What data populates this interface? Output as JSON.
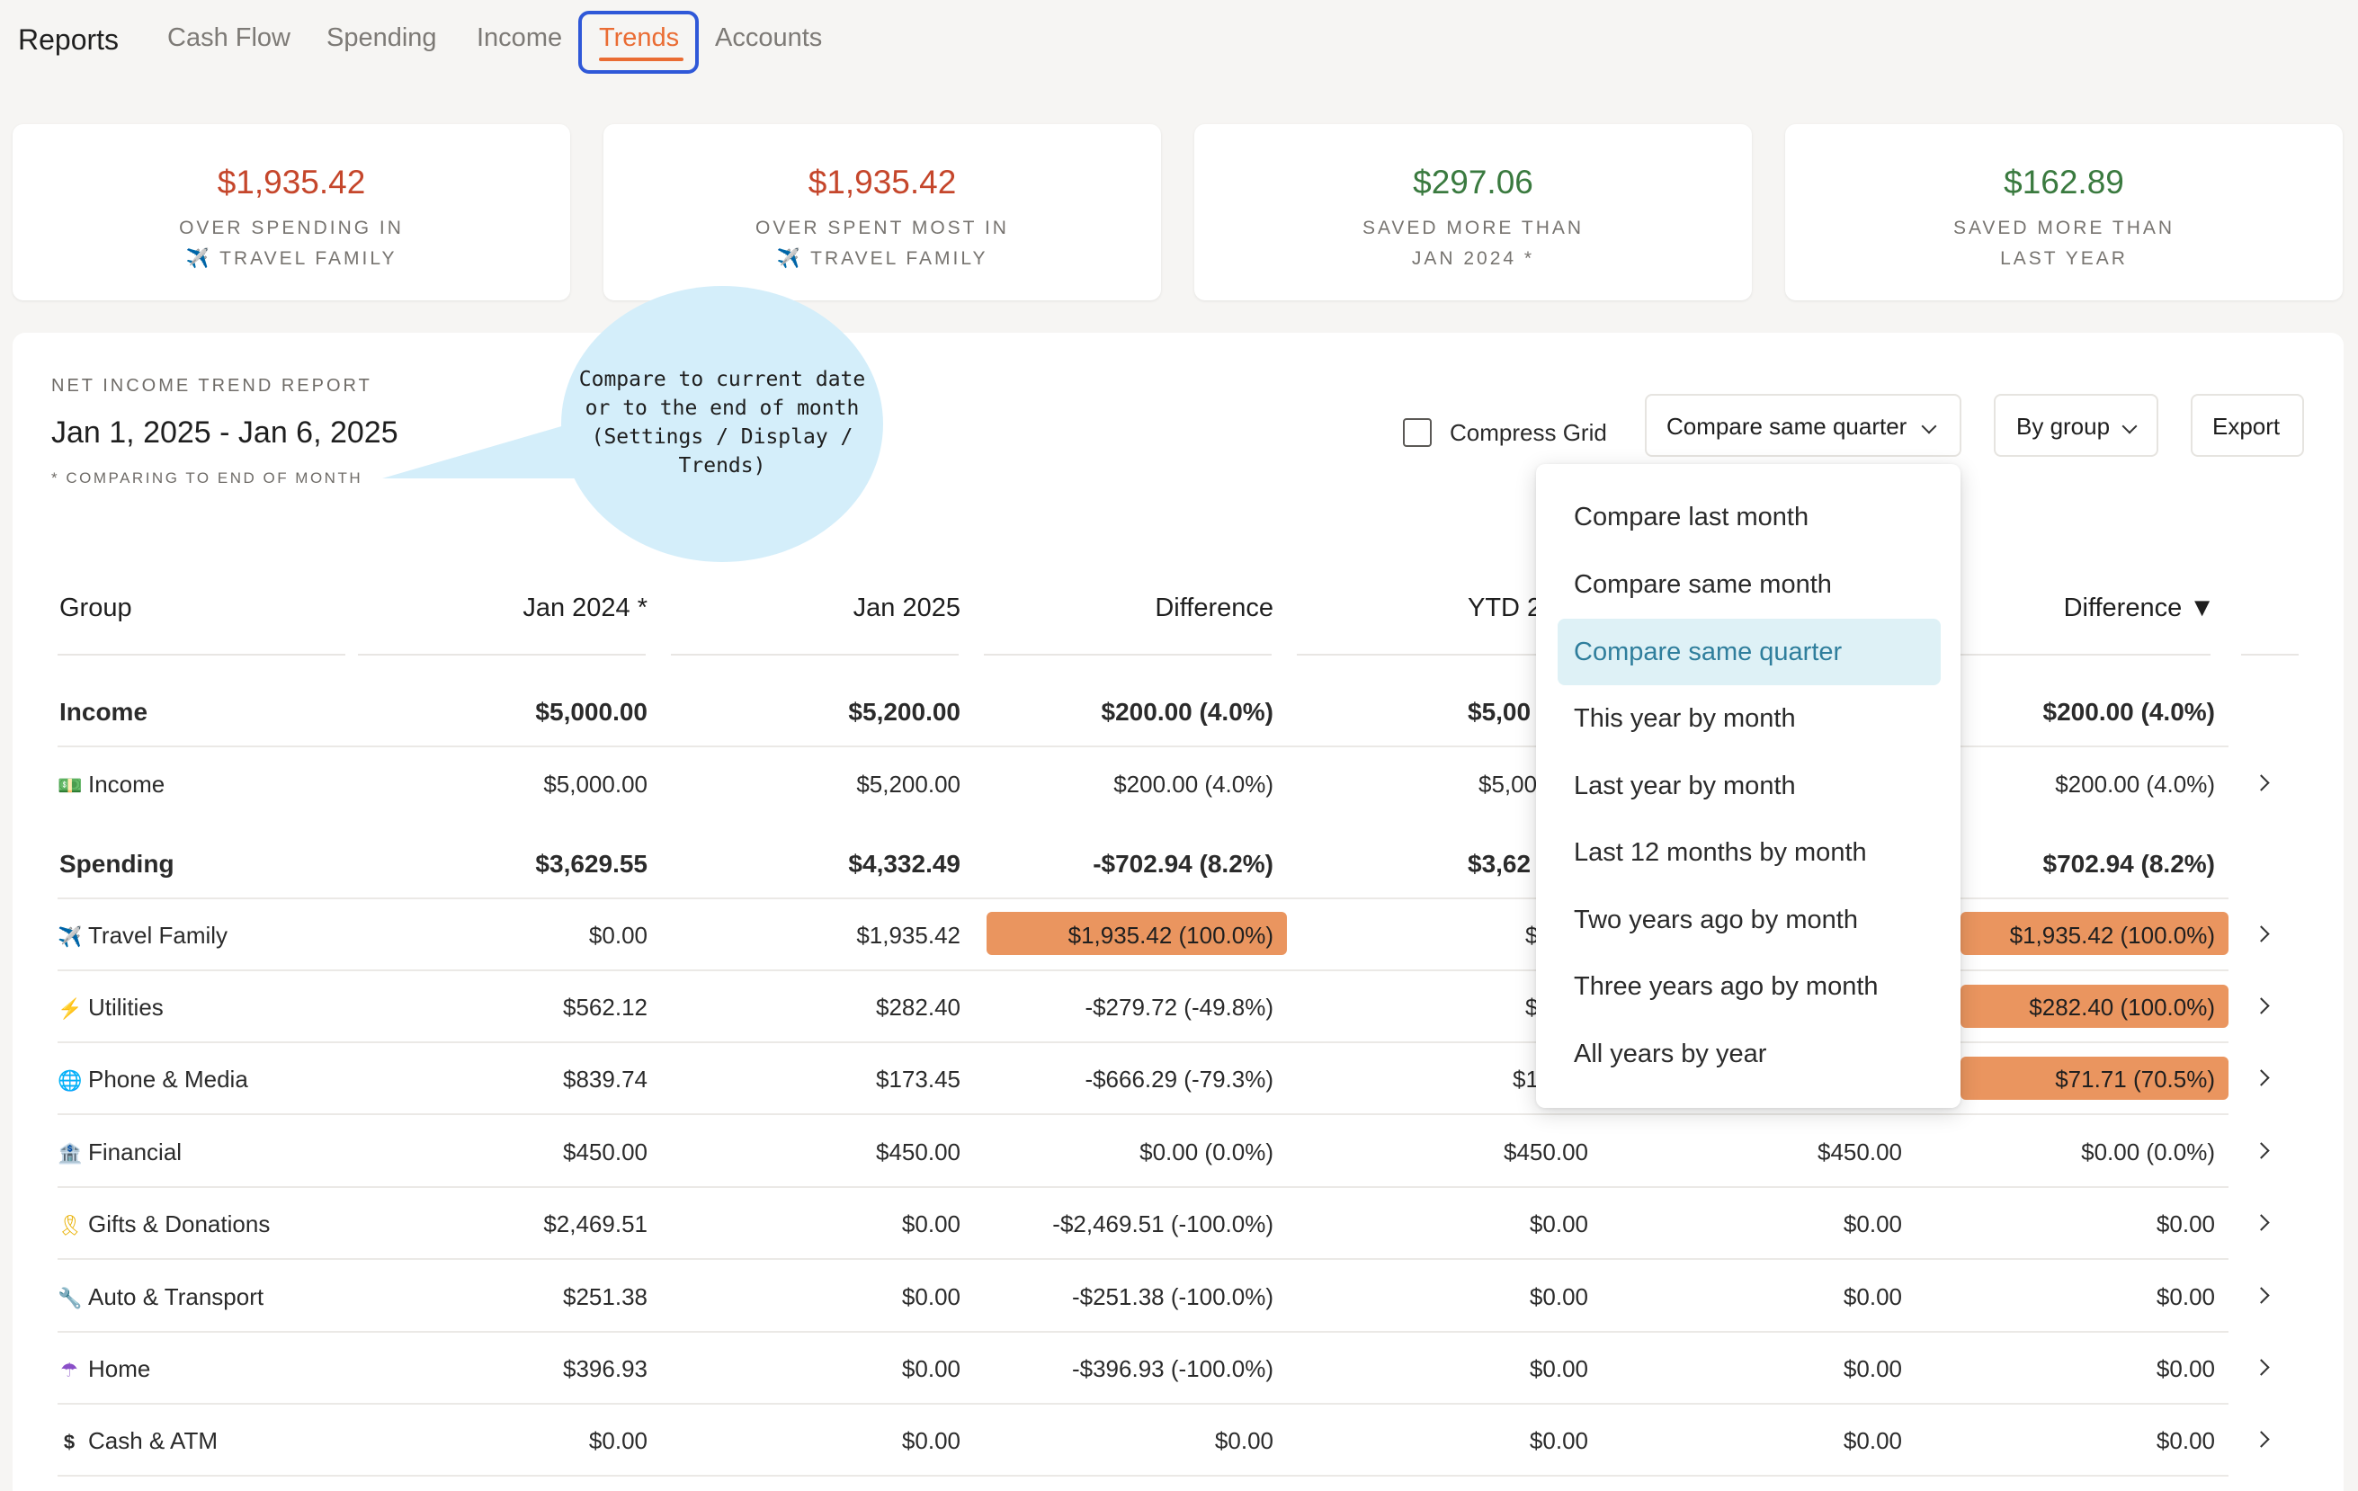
{
  "nav": {
    "brand": "Reports",
    "tabs": [
      "Cash Flow",
      "Spending",
      "Income",
      "Trends",
      "Accounts"
    ],
    "active_tab": "Trends"
  },
  "cards": [
    {
      "amount": "$1,935.42",
      "line1": "OVER SPENDING IN",
      "line2": "✈️ TRAVEL FAMILY",
      "tone": "red"
    },
    {
      "amount": "$1,935.42",
      "line1": "OVER SPENT MOST IN",
      "line2": "✈️ TRAVEL FAMILY",
      "tone": "red"
    },
    {
      "amount": "$297.06",
      "line1": "SAVED MORE THAN",
      "line2": "JAN 2024 *",
      "tone": "green"
    },
    {
      "amount": "$162.89",
      "line1": "SAVED MORE THAN",
      "line2": "LAST YEAR",
      "tone": "green"
    }
  ],
  "report": {
    "eyebrow": "NET INCOME TREND REPORT",
    "dates": "Jan 1, 2025 - Jan 6, 2025",
    "note": "* COMPARING TO END OF MONTH"
  },
  "callout": {
    "line1": "Compare to current date",
    "line2": "or to the end of month",
    "line3": "(Settings / Display / Trends)"
  },
  "toolbar": {
    "compress_label": "Compress Grid",
    "compress_checked": false,
    "compare_label": "Compare same quarter",
    "group_label": "By group",
    "export_label": "Export"
  },
  "menu": {
    "items": [
      "Compare last month",
      "Compare same month",
      "Compare same quarter",
      "This year by month",
      "Last year by month",
      "Last 12 months by month",
      "Two years ago by month",
      "Three years ago by month",
      "All years by year"
    ],
    "selected": "Compare same quarter"
  },
  "table": {
    "headers": {
      "group": "Group",
      "c1": "Jan 2024 *",
      "c2": "Jan 2025",
      "c3": "Difference",
      "c4": "YTD 2",
      "c6": "Difference ▼"
    },
    "rows": [
      {
        "type": "group",
        "name": "Income",
        "c1": "$5,000.00",
        "c2": "$5,200.00",
        "c3": "$200.00 (4.0%)",
        "c4": "$5,00",
        "c5": "",
        "c6": "$200.00 (4.0%)"
      },
      {
        "type": "item",
        "icon": "💵",
        "name": "Income",
        "c1": "$5,000.00",
        "c2": "$5,200.00",
        "c3": "$200.00 (4.0%)",
        "c4": "$5,00",
        "c5": "",
        "c6": "$200.00 (4.0%)"
      },
      {
        "type": "group",
        "name": "Spending",
        "c1": "$3,629.55",
        "c2": "$4,332.49",
        "c3": "-$702.94 (8.2%)",
        "c4": "$3,62",
        "c5": "",
        "c6": "$702.94 (8.2%)"
      },
      {
        "type": "item",
        "icon": "✈️",
        "name": "Travel Family",
        "c1": "$0.00",
        "c2": "$1,935.42",
        "c3": "$1,935.42 (100.0%)",
        "c4": "$",
        "c5": "",
        "c6": "$1,935.42 (100.0%)"
      },
      {
        "type": "item",
        "icon": "⚡",
        "name": "Utilities",
        "c1": "$562.12",
        "c2": "$282.40",
        "c3": "-$279.72 (-49.8%)",
        "c4": "$",
        "c5": "",
        "c6": "$282.40 (100.0%)"
      },
      {
        "type": "item",
        "icon": "🌐",
        "name": "Phone & Media",
        "c1": "$839.74",
        "c2": "$173.45",
        "c3": "-$666.29 (-79.3%)",
        "c4": "$1",
        "c5": "",
        "c6": "$71.71 (70.5%)"
      },
      {
        "type": "item",
        "icon": "🏦",
        "name": "Financial",
        "c1": "$450.00",
        "c2": "$450.00",
        "c3": "$0.00 (0.0%)",
        "c4": "$450.00",
        "c5": "$450.00",
        "c6": "$0.00 (0.0%)"
      },
      {
        "type": "item",
        "icon": "🎗",
        "name": "Gifts & Donations",
        "c1": "$2,469.51",
        "c2": "$0.00",
        "c3": "-$2,469.51 (-100.0%)",
        "c4": "$0.00",
        "c5": "$0.00",
        "c6": "$0.00"
      },
      {
        "type": "item",
        "icon": "🔧",
        "name": "Auto & Transport",
        "c1": "$251.38",
        "c2": "$0.00",
        "c3": "-$251.38 (-100.0%)",
        "c4": "$0.00",
        "c5": "$0.00",
        "c6": "$0.00"
      },
      {
        "type": "item",
        "icon": "☂",
        "name": "Home",
        "c1": "$396.93",
        "c2": "$0.00",
        "c3": "-$396.93 (-100.0%)",
        "c4": "$0.00",
        "c5": "$0.00",
        "c6": "$0.00"
      },
      {
        "type": "item",
        "icon": "$",
        "name": "Cash & ATM",
        "c1": "$0.00",
        "c2": "$0.00",
        "c3": "$0.00",
        "c4": "$0.00",
        "c5": "$0.00",
        "c6": "$0.00"
      }
    ]
  },
  "colors": {
    "accent": "#ea6c33",
    "negative": "#c5462b",
    "positive": "#3a7a3f",
    "highlight": "#ea955f",
    "focus_ring": "#2f58d8",
    "callout": "#d4eefa",
    "menu_selected": "#def1f6"
  }
}
